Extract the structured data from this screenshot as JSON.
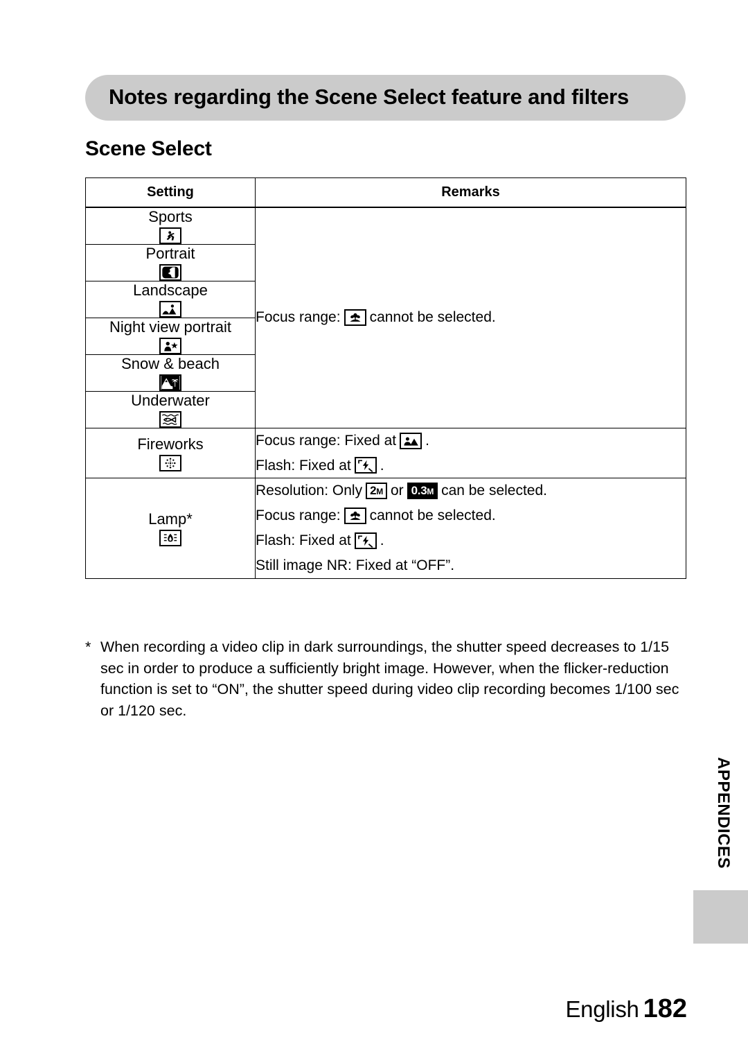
{
  "banner": {
    "title": "Notes regarding the Scene Select feature and filters"
  },
  "section": {
    "heading": "Scene Select"
  },
  "table": {
    "headers": {
      "setting": "Setting",
      "remarks": "Remarks"
    },
    "shared_remark": {
      "prefix": "Focus range:",
      "icon": "macro-flower-icon",
      "suffix": "cannot be selected."
    },
    "rows": [
      {
        "label": "Sports",
        "icon": "sports-runner-icon"
      },
      {
        "label": "Portrait",
        "icon": "portrait-bust-icon"
      },
      {
        "label": "Landscape",
        "icon": "landscape-hills-icon"
      },
      {
        "label": "Night view portrait",
        "icon": "night-view-portrait-icon"
      },
      {
        "label": "Snow & beach",
        "icon": "snow-beach-icon"
      },
      {
        "label": "Underwater",
        "icon": "underwater-fish-icon"
      }
    ],
    "fireworks": {
      "label": "Fireworks",
      "icon": "fireworks-burst-icon",
      "lines": [
        {
          "prefix": "Focus range: Fixed at",
          "icon": "focus-infinity-icon",
          "suffix": "."
        },
        {
          "prefix": "Flash: Fixed at",
          "icon": "flash-off-icon",
          "suffix": "."
        }
      ]
    },
    "lamp": {
      "label": "Lamp*",
      "icon": "lamp-flame-icon",
      "lines": [
        {
          "type": "resolution",
          "prefix": "Resolution: Only",
          "chip1": "2M",
          "chip1_unit": "M",
          "chip1_num": "2",
          "middle": "or",
          "chip2_num": "0.3",
          "chip2_unit": "M",
          "suffix": "can be selected."
        },
        {
          "type": "icon",
          "prefix": "Focus range:",
          "icon": "macro-flower-icon",
          "suffix": "cannot be selected."
        },
        {
          "type": "icon",
          "prefix": "Flash: Fixed at",
          "icon": "flash-off-icon",
          "suffix": "."
        },
        {
          "type": "text",
          "text": "Still image NR: Fixed at “OFF”."
        }
      ]
    }
  },
  "footnote": {
    "marker": "*",
    "text": "When recording a video clip in dark surroundings, the shutter speed decreases to 1/15 sec in order to produce a sufficiently bright image. However, when the flicker-reduction function is set to “ON”, the shutter speed during video clip recording becomes 1/100 sec or 1/120 sec."
  },
  "side_tab": {
    "label": "APPENDICES",
    "color": "#cbcbcb"
  },
  "footer": {
    "language": "English",
    "page_number": "182"
  }
}
